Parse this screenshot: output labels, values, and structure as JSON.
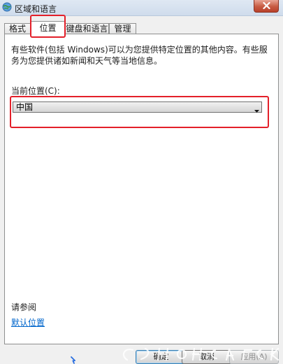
{
  "window": {
    "title": "区域和语言"
  },
  "tabs": [
    {
      "label": "格式",
      "active": false
    },
    {
      "label": "位置",
      "active": true
    },
    {
      "label": "键盘和语言",
      "active": false
    },
    {
      "label": "管理",
      "active": false
    }
  ],
  "location": {
    "description": "有些软件(包括 Windows)可以为您提供特定位置的其他内容。有些服务为您提供诸如新闻和天气等当地信息。",
    "current_label": "当前位置(C):",
    "selected_value": "中国"
  },
  "see_also": {
    "heading": "请参阅",
    "link_label": "默认位置"
  },
  "buttons": {
    "ok": "确定",
    "cancel": "取消",
    "apply": "应用(A)"
  },
  "colors": {
    "highlight": "#e3202a",
    "link": "#0066cc"
  },
  "icons": {
    "app": "globe-clock-icon",
    "close": "close-icon",
    "dropdown": "chevron-down-icon"
  }
}
